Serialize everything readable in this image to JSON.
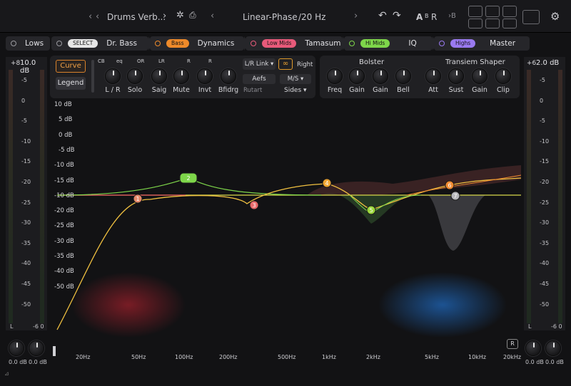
{
  "topbar": {
    "preset_name": "Drums Verb...",
    "mode": "Linear-Phase",
    "mode_value": "/20 Hz",
    "ab_a": "A",
    "ab_b": "B",
    "ab_r": "R",
    "ab_db": "›B"
  },
  "bands": [
    {
      "pill": "",
      "name": "Lows",
      "pill_color": ""
    },
    {
      "pill": "SELECT",
      "name": "Dr. Bass",
      "pill_color": "#e6e6e6"
    },
    {
      "pill": "Bass",
      "name": "Dynamics",
      "pill_color": "#ee8a2a"
    },
    {
      "pill": "Low Mids",
      "name": "Tamasum",
      "pill_color": "#e85a7a"
    },
    {
      "pill": "Hi Mids",
      "name": "IQ",
      "pill_color": "#7ed64a"
    },
    {
      "pill": "Highs",
      "name": "Master",
      "pill_color": "#9a7af0"
    }
  ],
  "left_meter": {
    "gain": "10.0 dB",
    "scale": [
      "+8",
      "-5",
      "0",
      "-5",
      "-10",
      "-15",
      "-20",
      "-25",
      "-30",
      "-35",
      "-40",
      "-45",
      "-50"
    ],
    "ch_l": "L",
    "ch_r": "-6 0",
    "knob1": "0.0 dB",
    "knob2": "0.0 dB"
  },
  "right_meter": {
    "gain": "2.0 dB",
    "scale": [
      "+6",
      "-5",
      "0",
      "-5",
      "-10",
      "-15",
      "-20",
      "-25",
      "-30",
      "-35",
      "-40",
      "-45",
      "-50"
    ],
    "ch_l": "L",
    "ch_r": "-6 0",
    "knob1": "0.0 dB",
    "knob2": "0.0 dB",
    "btn": "R"
  },
  "controls": {
    "curve": "Curve",
    "legend": "Legend",
    "small_labels": [
      "CB",
      "eq",
      "OR",
      "LR",
      "R",
      "R"
    ],
    "knobs": [
      "L / R",
      "Solo",
      "Saig",
      "Mute",
      "Invt",
      "Bfidrg"
    ],
    "lr_link": "L/R Link",
    "right": "Right",
    "aefs": "Aefs",
    "rutart": "Rutart",
    "ms": "M/S",
    "sides": "Sides"
  },
  "bolster": {
    "title": "Bolster",
    "knobs": [
      "Freq",
      "Gain",
      "Gain",
      "Bell"
    ]
  },
  "transient": {
    "title": "Transiem Shaper",
    "knobs": [
      "Att",
      "Sust",
      "Gain",
      "Clip"
    ]
  },
  "graph": {
    "db_labels": [
      "10 dB",
      "5 dB",
      "0 dB",
      "-5 dB",
      "-10 dB",
      "-15 dB",
      "-10 dB",
      "-20 dB",
      "-25 dB",
      "-30 dB",
      "-35 dB",
      "-40 dB",
      "-50 dB"
    ],
    "freq_labels": [
      "20Hz",
      "50Hz",
      "100Hz",
      "200Hz",
      "500Hz",
      "1kHz",
      "2kHz",
      "5kHz",
      "10kHz",
      "20kHz"
    ],
    "nodes": [
      {
        "label": "1",
        "color": "#e58a6a"
      },
      {
        "label": "2",
        "color": "#7ed64a"
      },
      {
        "label": "3",
        "color": "#e86a6a"
      },
      {
        "label": "4",
        "color": "#f0a530"
      },
      {
        "label": "5",
        "color": "#9ad63a"
      },
      {
        "label": "6",
        "color": "#f08a30"
      },
      {
        "label": "7",
        "color": "#b8b8bc"
      }
    ]
  }
}
